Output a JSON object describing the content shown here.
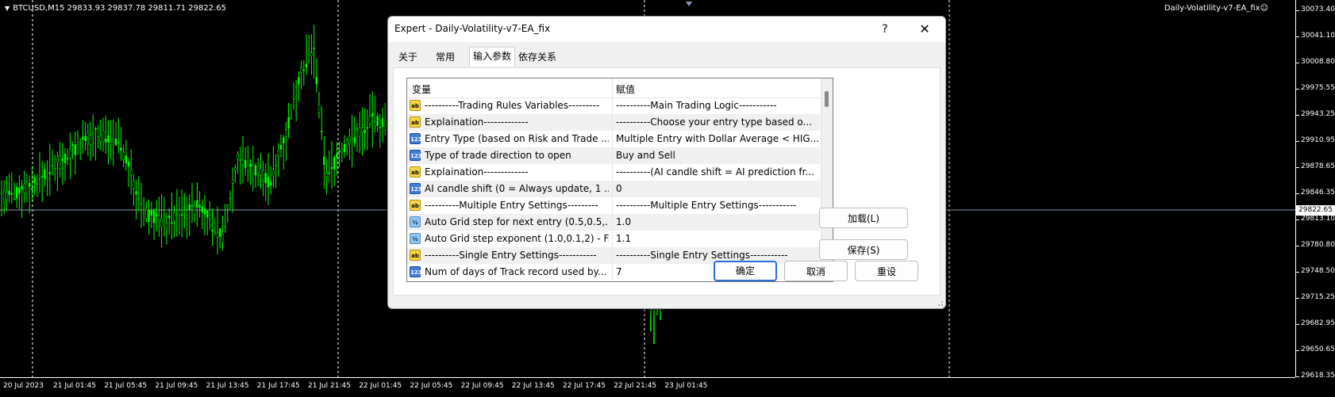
{
  "chart": {
    "symbol_info": "BTCUSD,M15  29833.93 29837.78 29811.71 29822.65",
    "ea_label": "Daily-Volatility-v7-EA_fix☺",
    "current_price": "29822.65",
    "price_ticks": [
      "30073.40",
      "30041.10",
      "30008.80",
      "29975.55",
      "29943.25",
      "29910.95",
      "29878.65",
      "29846.35",
      "29813.10",
      "29780.80",
      "29748.50",
      "29715.25",
      "29682.95",
      "29650.65",
      "29618.35"
    ],
    "time_ticks": [
      "20 Jul 2023",
      "21 Jul 01:45",
      "21 Jul 05:45",
      "21 Jul 09:45",
      "21 Jul 13:45",
      "21 Jul 17:45",
      "21 Jul 21:45",
      "22 Jul 01:45",
      "22 Jul 05:45",
      "22 Jul 09:45",
      "22 Jul 13:45",
      "22 Jul 17:45",
      "22 Jul 21:45",
      "23 Jul 01:45"
    ],
    "candle_color": "#00ff00",
    "colors": {
      "background": "#000000",
      "grid": "#ffffff",
      "candles": "#00ff00"
    }
  },
  "dialog": {
    "title": "Expert - Daily-Volatility-v7-EA_fix",
    "help": "?",
    "close": "✕",
    "tabs": [
      "关于",
      "常用",
      "输入参数",
      "依存关系"
    ],
    "active_tab": "输入参数",
    "table": {
      "col_variable": "变量",
      "col_value": "赋值",
      "rows": [
        {
          "icon": "ab",
          "variable": "----------Trading Rules Variables---------",
          "value": "----------Main Trading Logic-----------"
        },
        {
          "icon": "ab",
          "variable": "Explaination-------------",
          "value": "----------Choose your entry type based o..."
        },
        {
          "icon": "123",
          "variable": "Entry Type (based on Risk and Trade ...",
          "value": "Multiple Entry with Dollar Average < HIG..."
        },
        {
          "icon": "123",
          "variable": "Type of trade direction to open",
          "value": "Buy and Sell"
        },
        {
          "icon": "ab",
          "variable": "Explaination-------------",
          "value": "----------(AI candle shift = AI prediction fr..."
        },
        {
          "icon": "123",
          "variable": "AI candle shift (0 = Always update, 1 ...",
          "value": "0"
        },
        {
          "icon": "ab",
          "variable": "----------Multiple Entry Settings---------",
          "value": "----------Multiple Entry Settings-----------"
        },
        {
          "icon": "v2",
          "variable": "Auto Grid step for next entry (0.5,0.5,...",
          "value": "1.0"
        },
        {
          "icon": "v2",
          "variable": "Auto Grid step exponent (1.0,0.1,2) - F...",
          "value": "1.1"
        },
        {
          "icon": "ab",
          "variable": "----------Single Entry Settings-----------",
          "value": "----------Single Entry Settings-----------"
        },
        {
          "icon": "123",
          "variable": "Num of days of Track record used by...",
          "value": "7"
        }
      ]
    },
    "buttons": {
      "load": "加载(L)",
      "save": "保存(S)",
      "ok": "确定",
      "cancel": "取消",
      "reset": "重设"
    }
  }
}
